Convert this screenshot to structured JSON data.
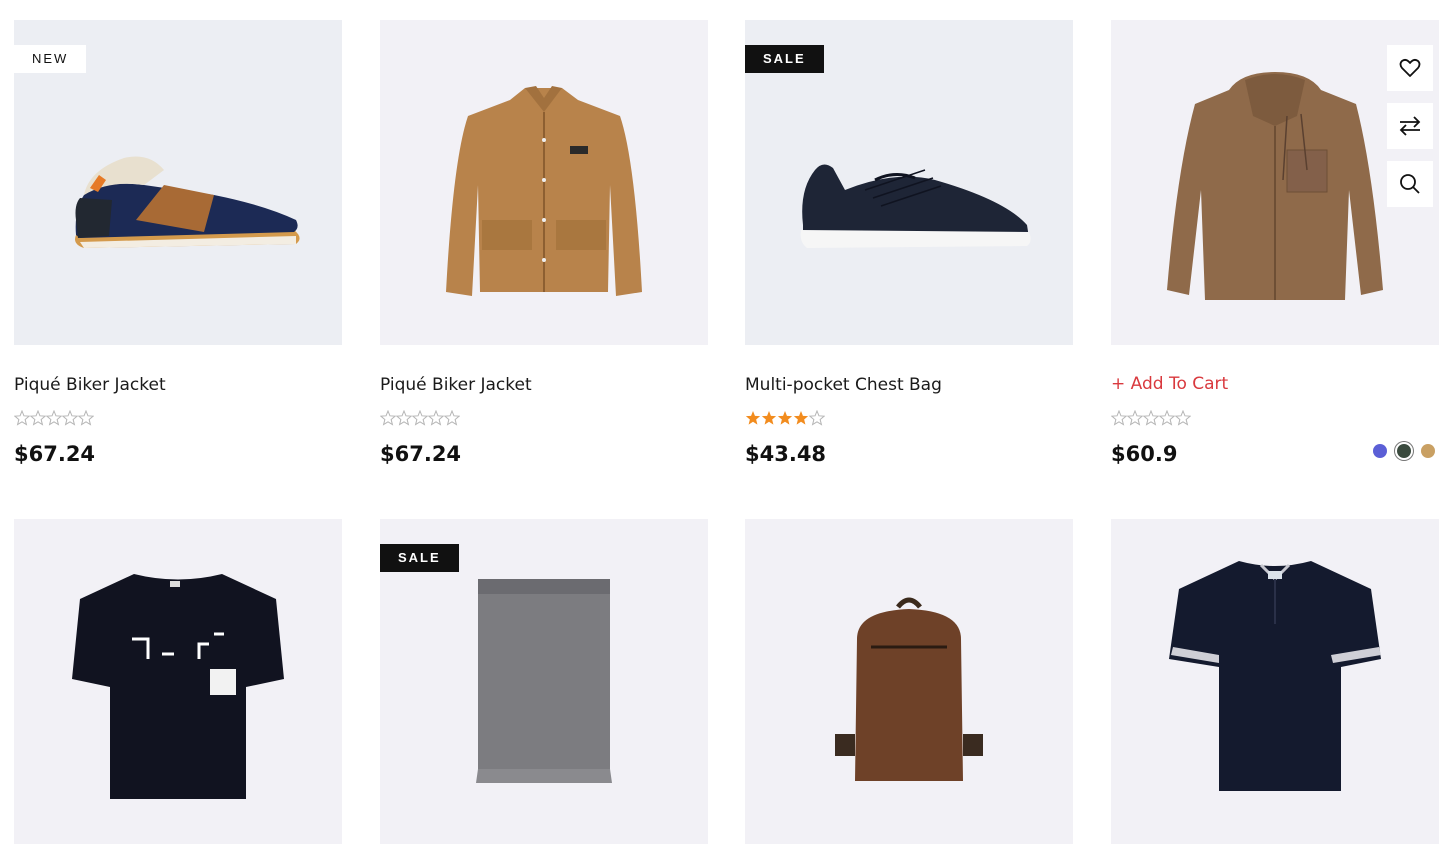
{
  "colors": {
    "accent": "#d9393e",
    "star_filled": "#f28c1e",
    "star_empty": "#b5b5b5",
    "badge_dark": "#111111"
  },
  "products": [
    {
      "badge": "NEW",
      "title": "Piqué Biker Jacket",
      "rating": 0,
      "price": "$67.24",
      "image": "sneaker-blue-icon"
    },
    {
      "badge": "",
      "title": "Piqué Biker Jacket",
      "rating": 0,
      "price": "$67.24",
      "image": "jacket-tan-icon"
    },
    {
      "badge": "SALE",
      "title": "Multi-pocket Chest Bag",
      "rating": 4,
      "price": "$43.48",
      "image": "sneaker-navy-icon"
    },
    {
      "badge": "",
      "add_to_cart": "+ Add To Cart",
      "rating": 0,
      "price": "$60.9",
      "image": "shirt-suede-icon",
      "actions": [
        "heart-icon",
        "compare-icon",
        "search-icon"
      ],
      "swatches": [
        "#5b5fd6",
        "#3a4a3e",
        "#c9a063"
      ]
    },
    {
      "badge": "",
      "image": "tshirt-black-icon"
    },
    {
      "badge": "SALE",
      "image": "scarf-grey-icon"
    },
    {
      "badge": "",
      "image": "backpack-brown-icon"
    },
    {
      "badge": "",
      "image": "polo-navy-icon"
    }
  ]
}
